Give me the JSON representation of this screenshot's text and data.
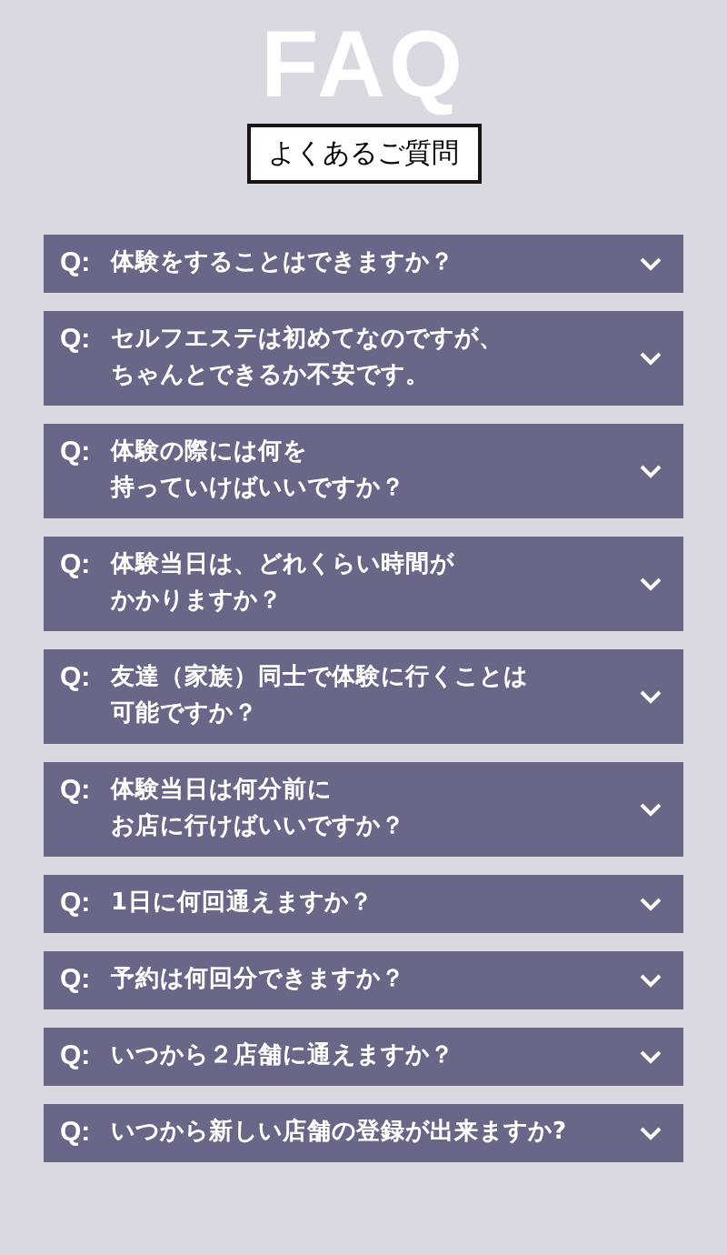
{
  "title": "FAQ",
  "subtitle": "よくあるご質問",
  "faqs": [
    {
      "label": "Q:",
      "lines": [
        "体験をすることはできますか？"
      ],
      "expanded": false
    },
    {
      "label": "Q:",
      "lines": [
        "セルフエステは初めてなのですが、",
        "ちゃんとできるか不安です。"
      ],
      "expanded": false
    },
    {
      "label": "Q:",
      "lines": [
        "体験の際には何を",
        "持っていけばいいですか？"
      ],
      "expanded": false
    },
    {
      "label": "Q:",
      "lines": [
        "体験当日は、どれくらい時間が",
        "かかりますか？"
      ],
      "expanded": false
    },
    {
      "label": "Q:",
      "lines": [
        "友達（家族）同士で体験に行くことは",
        "可能ですか？"
      ],
      "expanded": false
    },
    {
      "label": "Q:",
      "lines": [
        "体験当日は何分前に",
        "お店に行けばいいですか？"
      ],
      "expanded": false
    },
    {
      "label": "Q:",
      "lines": [
        "1日に何回通えますか？"
      ],
      "expanded": false
    },
    {
      "label": "Q:",
      "lines": [
        "予約は何回分できますか？"
      ],
      "expanded": false
    },
    {
      "label": "Q:",
      "lines": [
        "いつから２店舗に通えますか？"
      ],
      "expanded": false
    },
    {
      "label": "Q:",
      "lines": [
        "いつから新しい店舗の登録が出来ますか?"
      ],
      "expanded": false
    }
  ]
}
